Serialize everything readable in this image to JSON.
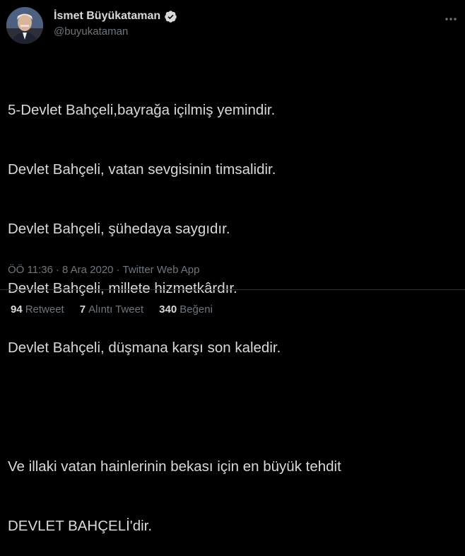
{
  "author": {
    "display_name": "İsmet Büyükataman",
    "handle": "@buyukataman",
    "verified": true,
    "avatar_icon": "profile-photo"
  },
  "more_icon": "more-horizontal-icon",
  "tweet": {
    "lines": [
      "5-Devlet Bahçeli,bayrağa içilmiş yemindir.",
      "Devlet Bahçeli, vatan sevgisinin timsalidir.",
      "Devlet Bahçeli, şühedaya saygıdır.",
      "Devlet Bahçeli, millete hizmetkârdır.",
      "Devlet Bahçeli, düşmana karşı son kaledir.",
      "",
      "Ve illaki vatan hainlerinin bekası için en büyük tehdit",
      "DEVLET BAHÇELİ'dir."
    ]
  },
  "meta": {
    "time": "ÖÖ 11:36",
    "separator1": "·",
    "date": "8 Ara 2020",
    "separator2": "·",
    "app": "Twitter Web App"
  },
  "stats": {
    "retweets": {
      "count": "94",
      "label": "Retweet"
    },
    "quotes": {
      "count": "7",
      "label": "Alıntı Tweet"
    },
    "likes": {
      "count": "340",
      "label": "Beğeni"
    }
  },
  "colors": {
    "background": "#000000",
    "text": "#d9d9d9",
    "muted": "#6e767d",
    "divider": "#2f3336"
  }
}
